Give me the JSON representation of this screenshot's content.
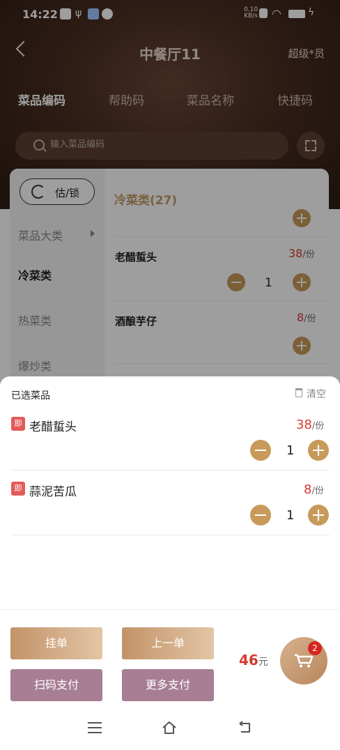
{
  "status_bar": {
    "time": "14:22",
    "net_speed_top": "0.10",
    "net_speed_bottom": "KB/s"
  },
  "nav": {
    "title": "中餐厅11",
    "user": "超级*员"
  },
  "tabs": [
    "菜品编码",
    "帮助码",
    "菜品名称",
    "快捷码"
  ],
  "search": {
    "placeholder": "输入菜品编码"
  },
  "sidebar": {
    "estimate_button": "估/锁",
    "items": [
      "菜品大类",
      "冷菜类",
      "热菜类",
      "爆炒类"
    ],
    "active_index": 1
  },
  "list": {
    "section_title": "冷菜类(27)",
    "dishes": [
      {
        "name": "老醋蜇头",
        "price": "38",
        "unit": "/份",
        "qty": "1"
      },
      {
        "name": "酒酿芋仔",
        "price": "8",
        "unit": "/份"
      }
    ]
  },
  "sheet": {
    "title": "已选菜品",
    "clear_label": "清空",
    "items": [
      {
        "badge": "即",
        "name": "老醋蜇头",
        "price": "38",
        "unit": "/份",
        "qty": "1"
      },
      {
        "badge": "即",
        "name": "蒜泥苦瓜",
        "price": "8",
        "unit": "/份",
        "qty": "1"
      }
    ]
  },
  "footer": {
    "btn_hold": "挂单",
    "btn_prev": "上一单",
    "btn_scan_pay": "扫码支付",
    "btn_more_pay": "更多支付",
    "total": "46",
    "currency": "元",
    "cart_count": "2"
  },
  "colors": {
    "accent": "#c89a5a",
    "price": "#d63a2f",
    "pay": "#a77e94",
    "header": "#4a2e22"
  }
}
